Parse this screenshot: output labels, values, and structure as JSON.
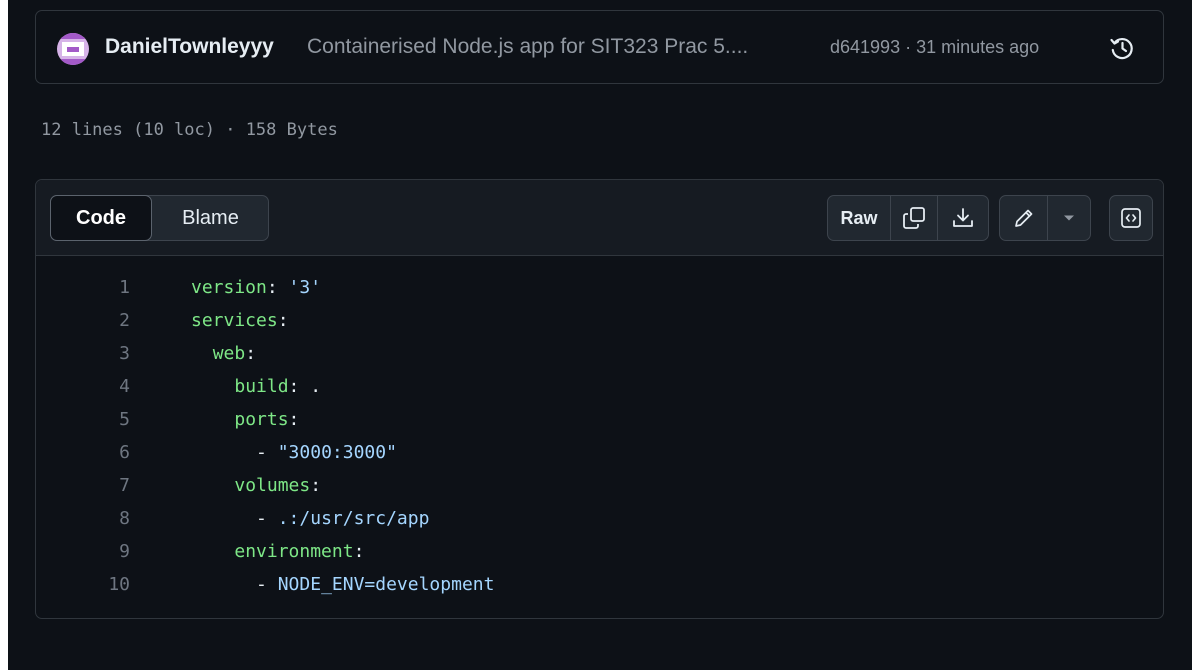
{
  "commit": {
    "author": "DanielTownleyyy",
    "message": "Containerised Node.js app for SIT323 Prac 5....",
    "hash_time": "d641993 · 31 minutes ago",
    "history_icon": "history-icon"
  },
  "file_info": "12 lines (10 loc) · 158 Bytes",
  "toolbar": {
    "tabs": [
      {
        "label": "Code",
        "selected": true
      },
      {
        "label": "Blame",
        "selected": false
      }
    ],
    "raw_label": "Raw",
    "icons": [
      "copy-icon",
      "download-icon",
      "pencil-icon",
      "chevron-down-icon",
      "code-symbols-icon"
    ]
  },
  "code": {
    "lines": [
      {
        "num": "1",
        "indent": "",
        "key": "version",
        "sep": ":",
        "val": " '3'",
        "valtype": "s"
      },
      {
        "num": "2",
        "indent": "",
        "key": "services",
        "sep": ":",
        "val": "",
        "valtype": "p"
      },
      {
        "num": "3",
        "indent": "  ",
        "key": "web",
        "sep": ":",
        "val": "",
        "valtype": "p"
      },
      {
        "num": "4",
        "indent": "    ",
        "key": "build",
        "sep": ":",
        "val": " .",
        "valtype": "p"
      },
      {
        "num": "5",
        "indent": "    ",
        "key": "ports",
        "sep": ":",
        "val": "",
        "valtype": "p"
      },
      {
        "num": "6",
        "indent": "      ",
        "key": "",
        "sep": "- ",
        "val": "\"3000:3000\"",
        "valtype": "s"
      },
      {
        "num": "7",
        "indent": "    ",
        "key": "volumes",
        "sep": ":",
        "val": "",
        "valtype": "p"
      },
      {
        "num": "8",
        "indent": "      ",
        "key": "",
        "sep": "- ",
        "val": ".:/usr/src/app",
        "valtype": "s"
      },
      {
        "num": "9",
        "indent": "    ",
        "key": "environment",
        "sep": ":",
        "val": "",
        "valtype": "p"
      },
      {
        "num": "10",
        "indent": "      ",
        "key": "",
        "sep": "- ",
        "val": "NODE_ENV=development",
        "valtype": "s"
      }
    ]
  },
  "colors": {
    "background": "#0d1117",
    "border": "#30363d",
    "yaml_key": "#7ee787",
    "yaml_string": "#a5d6ff",
    "muted": "#9198a1"
  }
}
